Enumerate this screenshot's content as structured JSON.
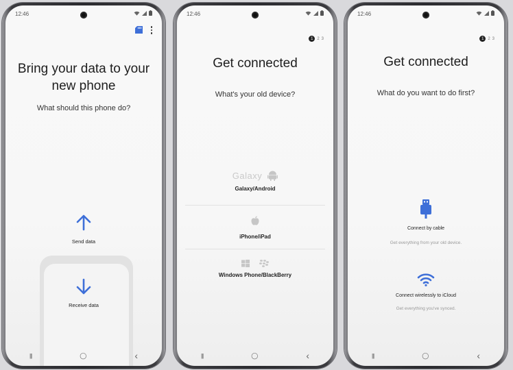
{
  "accent": "#3e6fd8",
  "status": {
    "time": "12:46"
  },
  "screen1": {
    "title_line1": "Bring your data to your",
    "title_line2": "new phone",
    "subtitle": "What should this phone do?",
    "send_label": "Send data",
    "receive_label": "Receive data",
    "icons": [
      "sd-card-icon",
      "more-options-icon",
      "arrow-up-icon",
      "arrow-down-icon"
    ]
  },
  "screen2": {
    "steps": [
      "1",
      "2",
      "3"
    ],
    "title": "Get connected",
    "subtitle": "What's your old device?",
    "options": [
      {
        "logo_text": "Galaxy",
        "label": "Galaxy/Android"
      },
      {
        "label": "iPhone/iPad"
      },
      {
        "label": "Windows Phone/BlackBerry"
      }
    ]
  },
  "screen3": {
    "steps": [
      "1",
      "2",
      "3"
    ],
    "title": "Get connected",
    "subtitle": "What do you want to do first?",
    "cable_label": "Connect by cable",
    "cable_desc": "Get everything from your old device.",
    "wireless_label": "Connect wirelessly to iCloud",
    "wireless_desc": "Get everything you've synced."
  },
  "navbar": {
    "recents": "|||",
    "home": "◯",
    "back": "‹"
  }
}
